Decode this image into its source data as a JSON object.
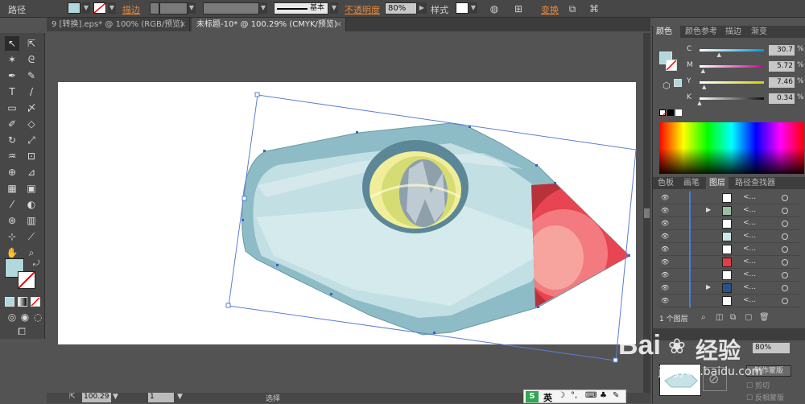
{
  "control_bar": {
    "object_type": "路径",
    "stroke_label": "描边",
    "stroke_profile": "基本",
    "opacity_label": "不透明度",
    "opacity_value": "80%",
    "style_label": "样式",
    "transform_label": "变换",
    "fill_color": "#b2d8dc"
  },
  "tabs": [
    {
      "label": "9 [转换].eps* @ 100% (RGB/预览)"
    },
    {
      "label": "未标题-10* @ 100.29% (CMYK/预览)"
    }
  ],
  "status_bar": {
    "zoom": "100.29",
    "page": "1",
    "tool_name": "选择"
  },
  "color_panel": {
    "tabs": [
      "颜色",
      "颜色参考",
      "描边",
      "渐变"
    ],
    "channels": [
      {
        "label": "C",
        "value": "30.7",
        "unit": "%",
        "percent": 30.7,
        "track": "#0099d6"
      },
      {
        "label": "M",
        "value": "5.72",
        "unit": "%",
        "percent": 5.72,
        "track": "#d0008f"
      },
      {
        "label": "Y",
        "value": "7.46",
        "unit": "%",
        "percent": 7.46,
        "track": "#d6d100"
      },
      {
        "label": "K",
        "value": "0.34",
        "unit": "%",
        "percent": 0.34,
        "track": "#111111"
      }
    ],
    "fill_color": "#b2d8dc"
  },
  "layers_panel": {
    "tabs": [
      "色板",
      "画笔",
      "图层",
      "路径查找器"
    ],
    "rows": [
      {
        "name": "<...",
        "thumb": "#ffffff"
      },
      {
        "name": "<...",
        "thumb": "#9bbfa0"
      },
      {
        "name": "<...",
        "thumb": "#ffffff"
      },
      {
        "name": "<...",
        "thumb": "#cfe6ea"
      },
      {
        "name": "<...",
        "thumb": "#ffffff"
      },
      {
        "name": "<...",
        "thumb": "#e23c48"
      },
      {
        "name": "<...",
        "thumb": "#ffffff"
      },
      {
        "name": "<...",
        "thumb": "#2f4e8a"
      },
      {
        "name": "<...",
        "thumb": "#ffffff"
      }
    ],
    "footer": "1 个图层"
  },
  "transparency_panel": {
    "opacity": "80%",
    "make_mask": "制作蒙版",
    "clip": "剪切",
    "invert_mask": "反相蒙版"
  },
  "watermark": {
    "brand": "Bai",
    "brand2": "经验",
    "url": "jingyan.baidu.com"
  },
  "ime_bar": {
    "label": "英"
  }
}
